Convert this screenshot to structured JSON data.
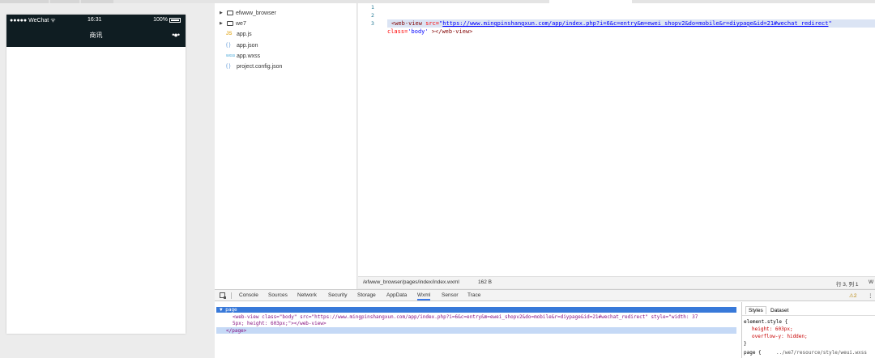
{
  "simulator": {
    "status": {
      "carrier": "●●●●● WeChat ᯤ",
      "time": "16:31",
      "battery": "100%"
    },
    "nav": {
      "title": "商讯",
      "menu": "•●•"
    }
  },
  "file_tree": {
    "items": [
      {
        "label": "efwww_browser",
        "type": "folder"
      },
      {
        "label": "we7",
        "type": "folder"
      },
      {
        "label": "app.js",
        "type": "js",
        "icon": "JS"
      },
      {
        "label": "app.json",
        "type": "json",
        "icon": "{ }"
      },
      {
        "label": "app.wxss",
        "type": "wxss",
        "icon": "wxss"
      },
      {
        "label": "project.config.json",
        "type": "json",
        "icon": "{ }"
      }
    ]
  },
  "editor": {
    "line_numbers": [
      "1",
      "2",
      "3"
    ],
    "code": {
      "open": "<web-view ",
      "src_attr": "src=",
      "q1": "\"",
      "url": "https://www.mingpinshangxun.com/app/index.php?i=6&c=entry&m=ewei_shopv2&do=mobile&r=diypage&id=21#wechat_redirect",
      "q2": "\"",
      "class_attr": "class=",
      "class_val": "'body'",
      "close": " ></web-view>"
    }
  },
  "editor_status": {
    "path": "/efwww_browser/pages/index/index.wxml",
    "size": "162 B",
    "position": "行 3, 列 1",
    "extra": "W"
  },
  "devtools": {
    "tabs": [
      "Console",
      "Sources",
      "Network",
      "Security",
      "Storage",
      "AppData",
      "Wxml",
      "Sensor",
      "Trace"
    ],
    "active_tab": "Wxml",
    "warnings": "⚠2",
    "more": "⋮",
    "dom": {
      "line1": "▼ page",
      "line2": "<web-view  class=\"body\"  src=\"https://www.mingpinshangxun.com/app/index.php?i=6&c=entry&m=ewei_shopv2&do=mobile&r=diypage&id=21#wechat_redirect\"  style=\"width: 37",
      "line3": "5px; height: 603px;\"></web-view>",
      "line4": "</page>"
    },
    "styles": {
      "tabs": [
        "Styles",
        "Dataset"
      ],
      "selector": "element.style {",
      "props": [
        "height: 603px;",
        "overflow-y: hidden;"
      ],
      "close": "}",
      "next_rule": "page {",
      "next_source": "../we7/resource/style/weui.wxss"
    }
  },
  "colors": {
    "nav_bg": "#0f1d22",
    "accent": "#3b78e7",
    "selection": "#3879d9"
  }
}
